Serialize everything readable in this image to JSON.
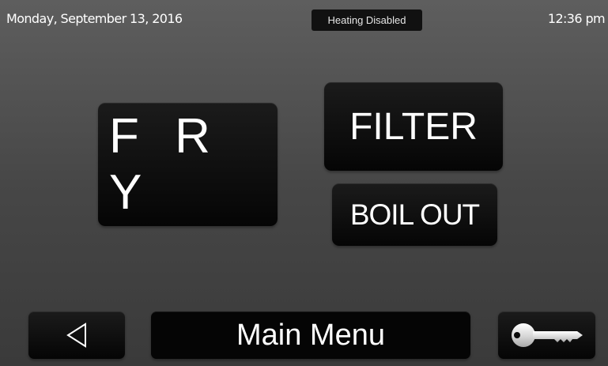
{
  "status_bar": {
    "date": "Monday, September 13, 2016",
    "status": "Heating Disabled",
    "time": "12:36 pm"
  },
  "main_buttons": {
    "fry": "F R Y",
    "filter": "FILTER",
    "boil_out": "BOIL OUT"
  },
  "bottom_bar": {
    "back_icon": "back-triangle-icon",
    "menu_title": "Main Menu",
    "key_icon": "key-icon"
  },
  "colors": {
    "button_bg": "#000000",
    "badge_bg": "#111111",
    "text": "#ffffff"
  }
}
